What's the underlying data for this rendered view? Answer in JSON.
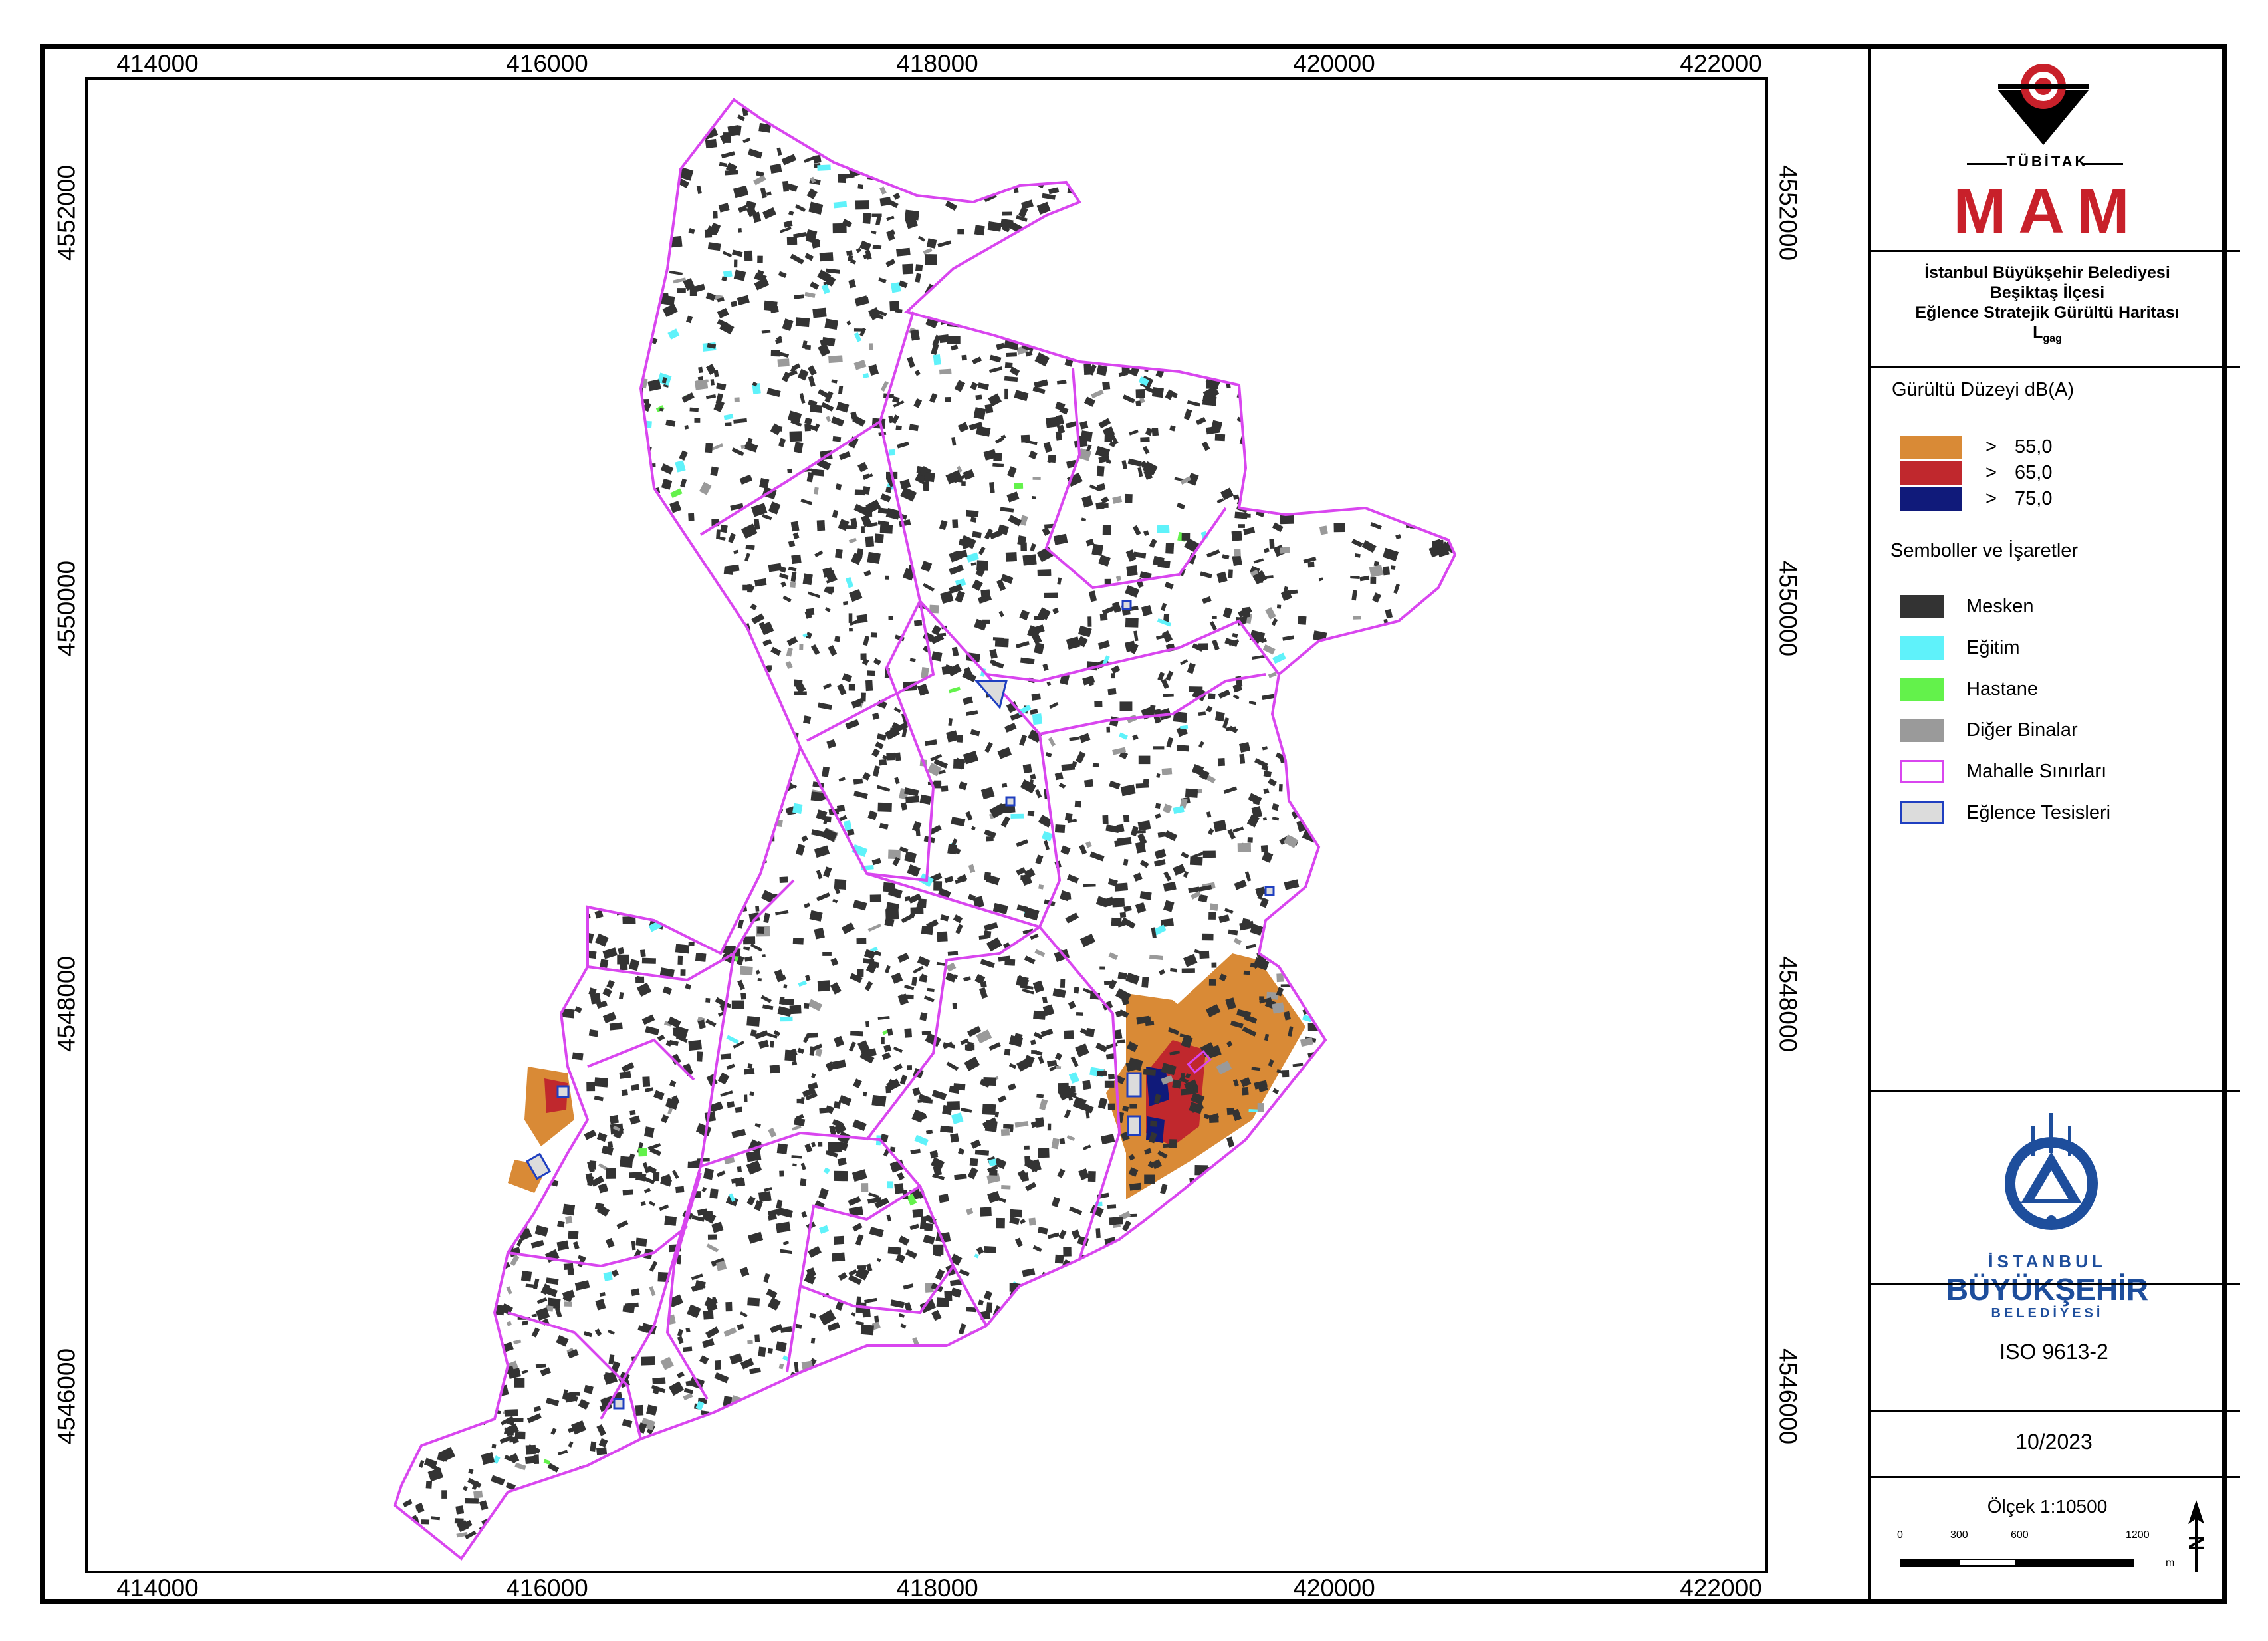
{
  "map": {
    "x_ticks": [
      "414000",
      "416000",
      "418000",
      "420000",
      "422000"
    ],
    "y_ticks": [
      "4552000",
      "4550000",
      "4548000",
      "4546000"
    ],
    "colors": {
      "district_fill": "#ffffff",
      "boundary": "#d946ef",
      "residential": "#333333",
      "education": "#5ff2fa",
      "hospital": "#63f24b",
      "other_buildings": "#9a9a9a",
      "noise_55": "#d98a36",
      "noise_65": "#c0282d",
      "noise_75": "#101a7a",
      "entertainment_fill": "#dcdcdc",
      "entertainment_border": "#1f3fc0"
    }
  },
  "logos": {
    "tubitak_text": "TÜBİTAK",
    "mam_text": "MAM",
    "ibb_line1": "İSTANBUL",
    "ibb_line2": "BÜYÜKŞEHİR",
    "ibb_line3": "BELEDİYESİ"
  },
  "title": {
    "line1": "İstanbul Büyükşehir Belediyesi",
    "line2": "Beşiktaş İlçesi",
    "line3": "Eğlence Stratejik Gürültü Haritası",
    "indicator_main": "L",
    "indicator_sub": "gag"
  },
  "noise_legend": {
    "heading": "Gürültü Düzeyi dB(A)",
    "items": [
      {
        "symbol": ">",
        "value": "55,0",
        "color": "#d98a36"
      },
      {
        "symbol": ">",
        "value": "65,0",
        "color": "#c0282d"
      },
      {
        "symbol": ">",
        "value": "75,0",
        "color": "#101a7a"
      }
    ]
  },
  "symbols_legend": {
    "heading": "Semboller ve İşaretler",
    "items": [
      {
        "label": "Mesken",
        "color": "#333333"
      },
      {
        "label": "Eğitim",
        "color": "#5ff2fa"
      },
      {
        "label": "Hastane",
        "color": "#63f24b"
      },
      {
        "label": "Diğer Binalar",
        "color": "#9a9a9a"
      },
      {
        "label": "Mahalle Sınırları",
        "color": "#d946ef"
      },
      {
        "label": "Eğlence Tesisleri",
        "color": "#1f3fc0"
      }
    ]
  },
  "standard": "ISO 9613-2",
  "date": "10/2023",
  "scale": {
    "label": "Ölçek 1:10500",
    "ticks": [
      "0",
      "300",
      "600",
      "1200"
    ],
    "unit": "m"
  },
  "north_arrow": "N"
}
